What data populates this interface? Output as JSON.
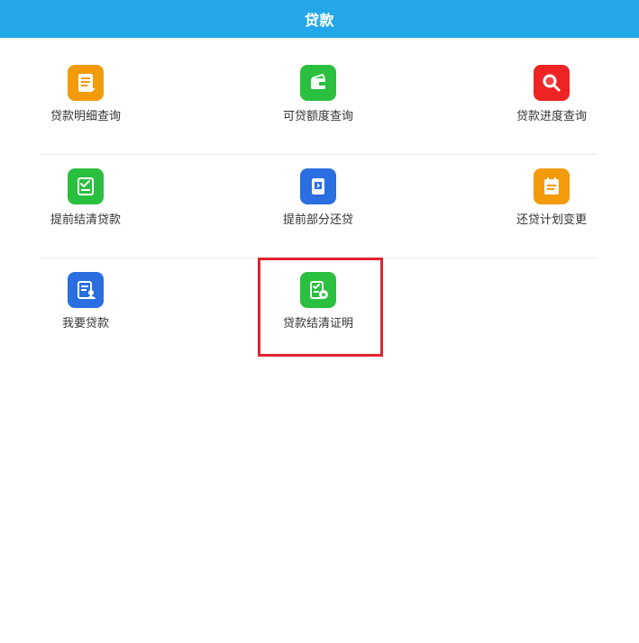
{
  "header": {
    "title": "贷款",
    "bg_color": "#23a7e8"
  },
  "grid": {
    "rows": [
      [
        {
          "label": "贷款明细查询",
          "icon": "document-list-icon",
          "color": "#f39b0b"
        },
        {
          "label": "可贷额度查询",
          "icon": "wallet-icon",
          "color": "#2bbf3f"
        },
        {
          "label": "贷款进度查询",
          "icon": "search-magnifier-icon",
          "color": "#ee2323"
        }
      ],
      [
        {
          "label": "提前结清贷款",
          "icon": "checklist-icon",
          "color": "#2bbf3f"
        },
        {
          "label": "提前部分还贷",
          "icon": "phone-transfer-icon",
          "color": "#2a6ee0"
        },
        {
          "label": "还贷计划变更",
          "icon": "calendar-plan-icon",
          "color": "#f39b0b"
        }
      ],
      [
        {
          "label": "我要贷款",
          "icon": "user-card-icon",
          "color": "#2a6ee0"
        },
        {
          "label": "贷款结清证明",
          "icon": "certificate-star-icon",
          "color": "#2bbf3f"
        }
      ]
    ]
  },
  "highlight": {
    "color": "#e2232f"
  }
}
